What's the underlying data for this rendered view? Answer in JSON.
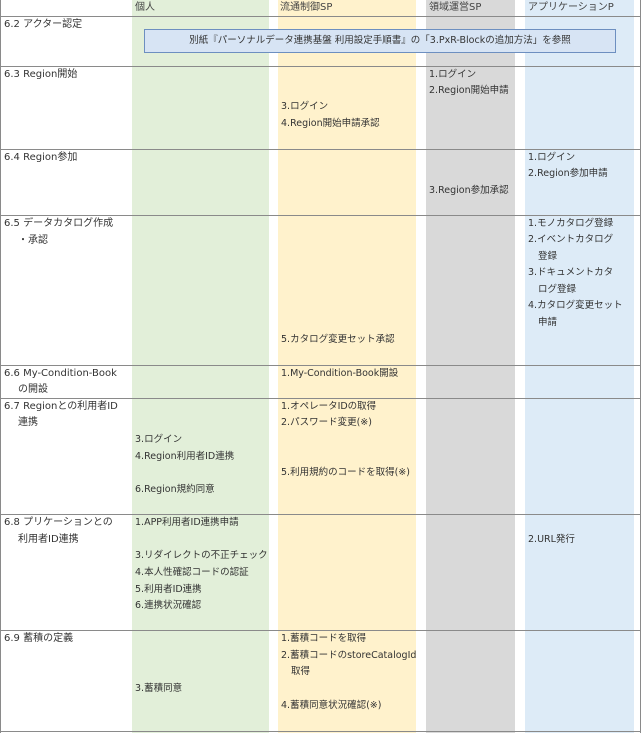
{
  "columns": {
    "individual": "個人",
    "distribution": "流通制御SP",
    "region": "領域運営SP",
    "app": "アプリケーションP"
  },
  "colors": {
    "individual_bg": "#e2efd9",
    "distribution_bg": "#fff2cc",
    "region_bg": "#d9d9d9",
    "app_bg": "#ddebf7",
    "border": "#8a8a8a",
    "banner_bg": "#d7e4f4",
    "banner_border": "#6d8fc0"
  },
  "rows": {
    "r62": {
      "label": "6.2 アクター認定",
      "banner": "別紙『パーソナルデータ連携基盤 利用設定手順書』の「3.PxR-Blockの追加方法」を参照"
    },
    "r63": {
      "label": "6.3 Region開始",
      "region": [
        "1.ログイン",
        "2.Region開始申請"
      ],
      "distribution": [
        "3.ログイン",
        "4.Region開始申請承認"
      ]
    },
    "r64": {
      "label": "6.4 Region参加",
      "app": [
        "1.ログイン",
        "2.Region参加申請"
      ],
      "region": [
        "3.Region参加承認"
      ]
    },
    "r65": {
      "label": [
        "6.5 データカタログ作成",
        "・承認"
      ],
      "app": [
        "1.モノカタログ登録",
        "2.イベントカタログ",
        "登録",
        "3.ドキュメントカタ",
        "ログ登録",
        "4.カタログ変更セット",
        "申請"
      ],
      "distribution": [
        "5.カタログ変更セット承認"
      ]
    },
    "r66": {
      "label": [
        "6.6 My-Condition-Book",
        "の開設"
      ],
      "distribution": [
        "1.My-Condition-Book開設"
      ]
    },
    "r67": {
      "label": [
        "6.7 Regionとの利用者ID",
        "連携"
      ],
      "distribution": [
        "1.オペレータIDの取得",
        "2.パスワード変更(※)"
      ],
      "distribution_b": [
        "5.利用規約のコードを取得(※)"
      ],
      "individual": [
        "3.ログイン",
        "4.Region利用者ID連携"
      ],
      "individual_b": [
        "6.Region規約同意"
      ]
    },
    "r68": {
      "label": [
        "6.8 プリケーションとの",
        "利用者ID連携"
      ],
      "individual": [
        "1.APP利用者ID連携申請"
      ],
      "individual_b": [
        "3.リダイレクトの不正チェック",
        "4.本人性確認コードの認証",
        "5.利用者ID連携",
        "6.連携状況確認"
      ],
      "app": [
        "2.URL発行"
      ]
    },
    "r69": {
      "label": "6.9 蓄積の定義",
      "distribution": [
        "1.蓄積コードを取得",
        "2.蓄積コードのstoreCatalogId",
        "取得"
      ],
      "distribution_b": [
        "4.蓄積同意状況確認(※)"
      ],
      "individual": [
        "3.蓄積同意"
      ]
    }
  }
}
